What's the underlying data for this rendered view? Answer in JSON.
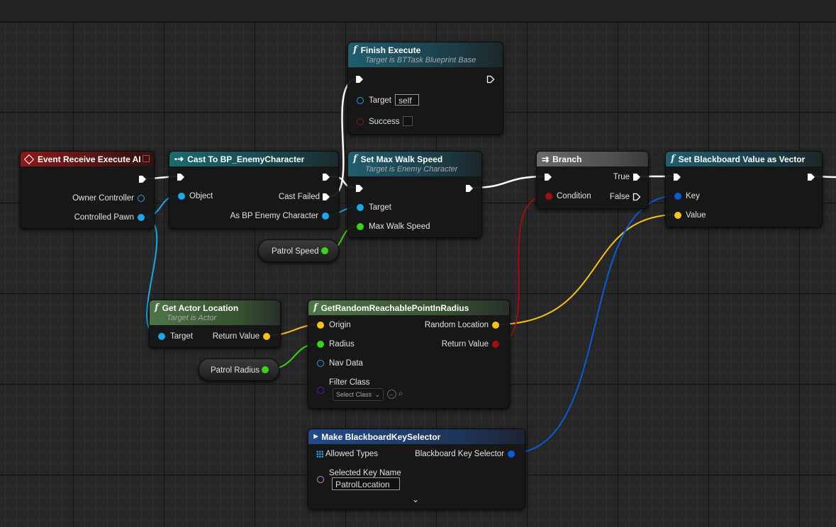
{
  "nodes": {
    "event_receive": {
      "title": "Event Receive Execute AI",
      "owner_controller": "Owner Controller",
      "controlled_pawn": "Controlled Pawn"
    },
    "cast": {
      "title": "Cast To BP_EnemyCharacter",
      "object": "Object",
      "cast_failed": "Cast Failed",
      "as_bp": "As BP Enemy Character"
    },
    "finish": {
      "title": "Finish Execute",
      "subtitle": "Target is BTTask Blueprint Base",
      "target": "Target",
      "target_value": "self",
      "success": "Success"
    },
    "set_speed": {
      "title": "Set Max Walk Speed",
      "subtitle": "Target is Enemy Character",
      "target": "Target",
      "max_walk_speed": "Max Walk Speed"
    },
    "branch": {
      "title": "Branch",
      "condition": "Condition",
      "true_label": "True",
      "false_label": "False"
    },
    "set_bb": {
      "title": "Set Blackboard Value as Vector",
      "key": "Key",
      "value": "Value"
    },
    "patrol_speed": {
      "label": "Patrol Speed"
    },
    "get_actor": {
      "title": "Get Actor Location",
      "subtitle": "Target is Actor",
      "target": "Target",
      "return_value": "Return Value"
    },
    "random_point": {
      "title": "GetRandomReachablePointInRadius",
      "origin": "Origin",
      "radius": "Radius",
      "nav_data": "Nav Data",
      "filter_class": "Filter Class",
      "select_class": "Select Class",
      "random_location": "Random Location",
      "return_value": "Return Value"
    },
    "patrol_radius": {
      "label": "Patrol Radius"
    },
    "make_key": {
      "title": "Make BlackboardKeySelector",
      "allowed_types": "Allowed Types",
      "key_selector": "Blackboard Key Selector",
      "selected_key_name": "Selected Key Name",
      "key_name_value": "PatrolLocation"
    }
  },
  "colors": {
    "exec": "#ffffff",
    "object": "#1aa7ec",
    "float": "#39d419",
    "vector": "#f8c219",
    "bool": "#a10e0e",
    "struct": "#0a5bd6",
    "class": "#6a0fcf",
    "name": "#b78ad6",
    "event_header": "#8c1a1a",
    "cast_header": "#1b5f63",
    "function_header": "#1f5c6b",
    "pure_header": "#4a6e42",
    "branch_header": "#5a5a5a",
    "make_header": "#1e3f78"
  }
}
